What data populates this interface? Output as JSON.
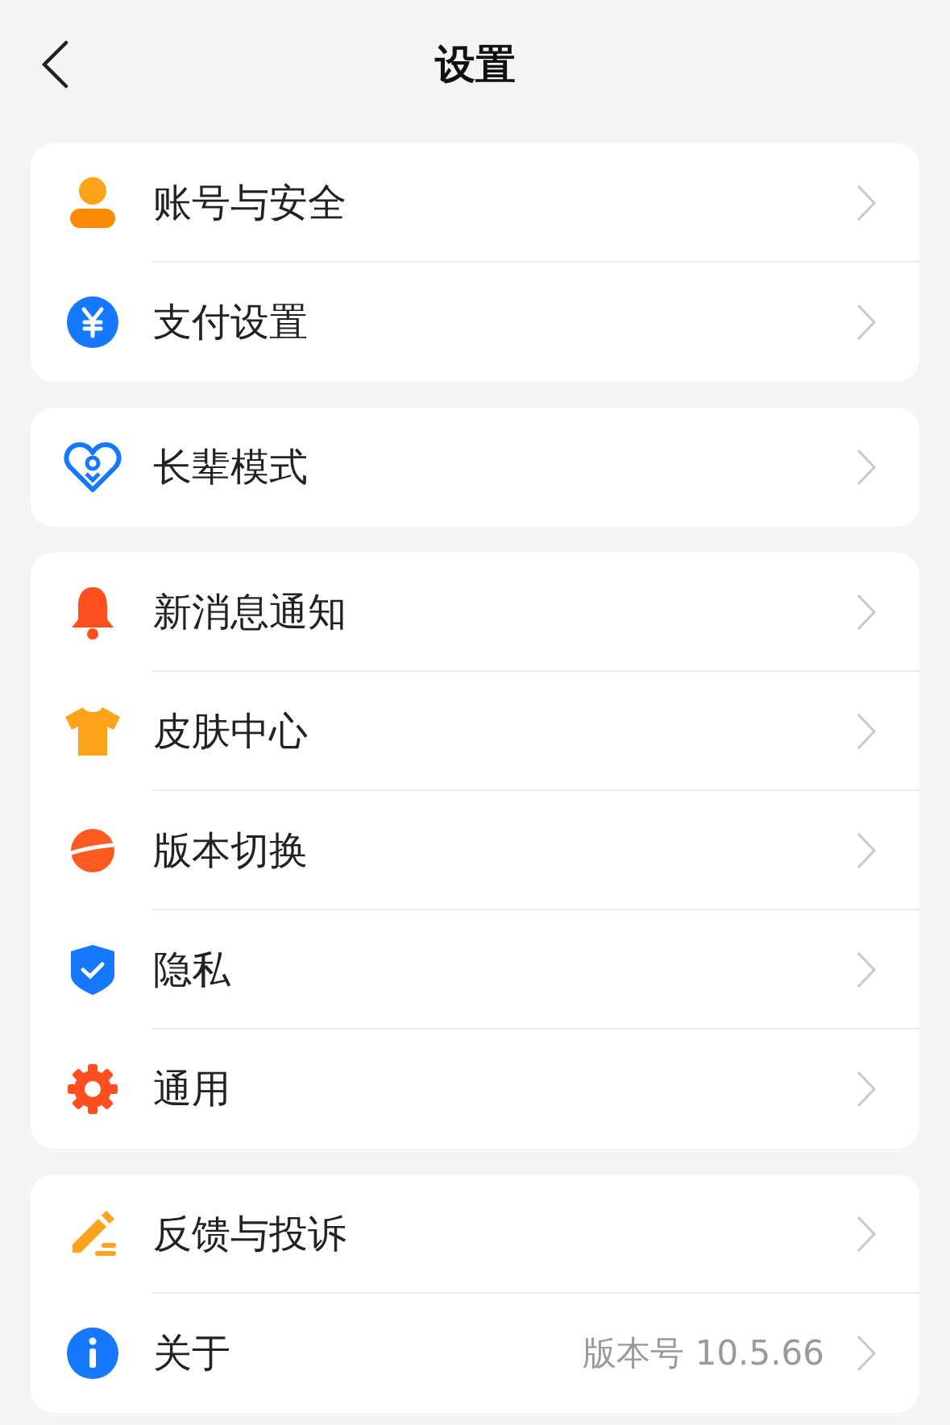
{
  "header": {
    "title": "设置"
  },
  "groups": [
    {
      "items": [
        {
          "label": "账号与安全"
        },
        {
          "label": "支付设置"
        }
      ]
    },
    {
      "items": [
        {
          "label": "长辈模式"
        }
      ]
    },
    {
      "items": [
        {
          "label": "新消息通知"
        },
        {
          "label": "皮肤中心"
        },
        {
          "label": "版本切换"
        },
        {
          "label": "隐私"
        },
        {
          "label": "通用"
        }
      ]
    },
    {
      "items": [
        {
          "label": "反馈与投诉"
        },
        {
          "label": "关于",
          "value": "版本号 10.5.66"
        }
      ]
    }
  ]
}
